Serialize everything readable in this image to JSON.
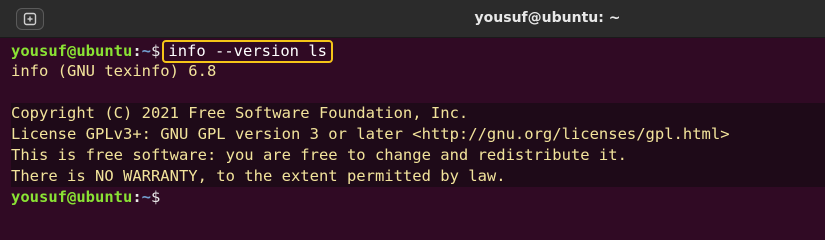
{
  "window": {
    "title": "yousuf@ubuntu: ~"
  },
  "icons": {
    "new_tab": "new-tab-icon"
  },
  "prompt": {
    "user_host": "yousuf@ubuntu",
    "colon": ":",
    "path": "~",
    "dollar": "$"
  },
  "command": "info --version ls",
  "output": [
    "info (GNU texinfo) 6.8",
    "",
    "Copyright (C) 2021 Free Software Foundation, Inc.",
    "License GPLv3+: GNU GPL version 3 or later <http://gnu.org/licenses/gpl.html>",
    "This is free software: you are free to change and redistribute it.",
    "There is NO WARRANTY, to the extent permitted by law."
  ],
  "colors": {
    "background": "#300a24",
    "prompt_user": "#8ae234",
    "prompt_path": "#729fcf",
    "highlight_border": "#f5c518"
  }
}
